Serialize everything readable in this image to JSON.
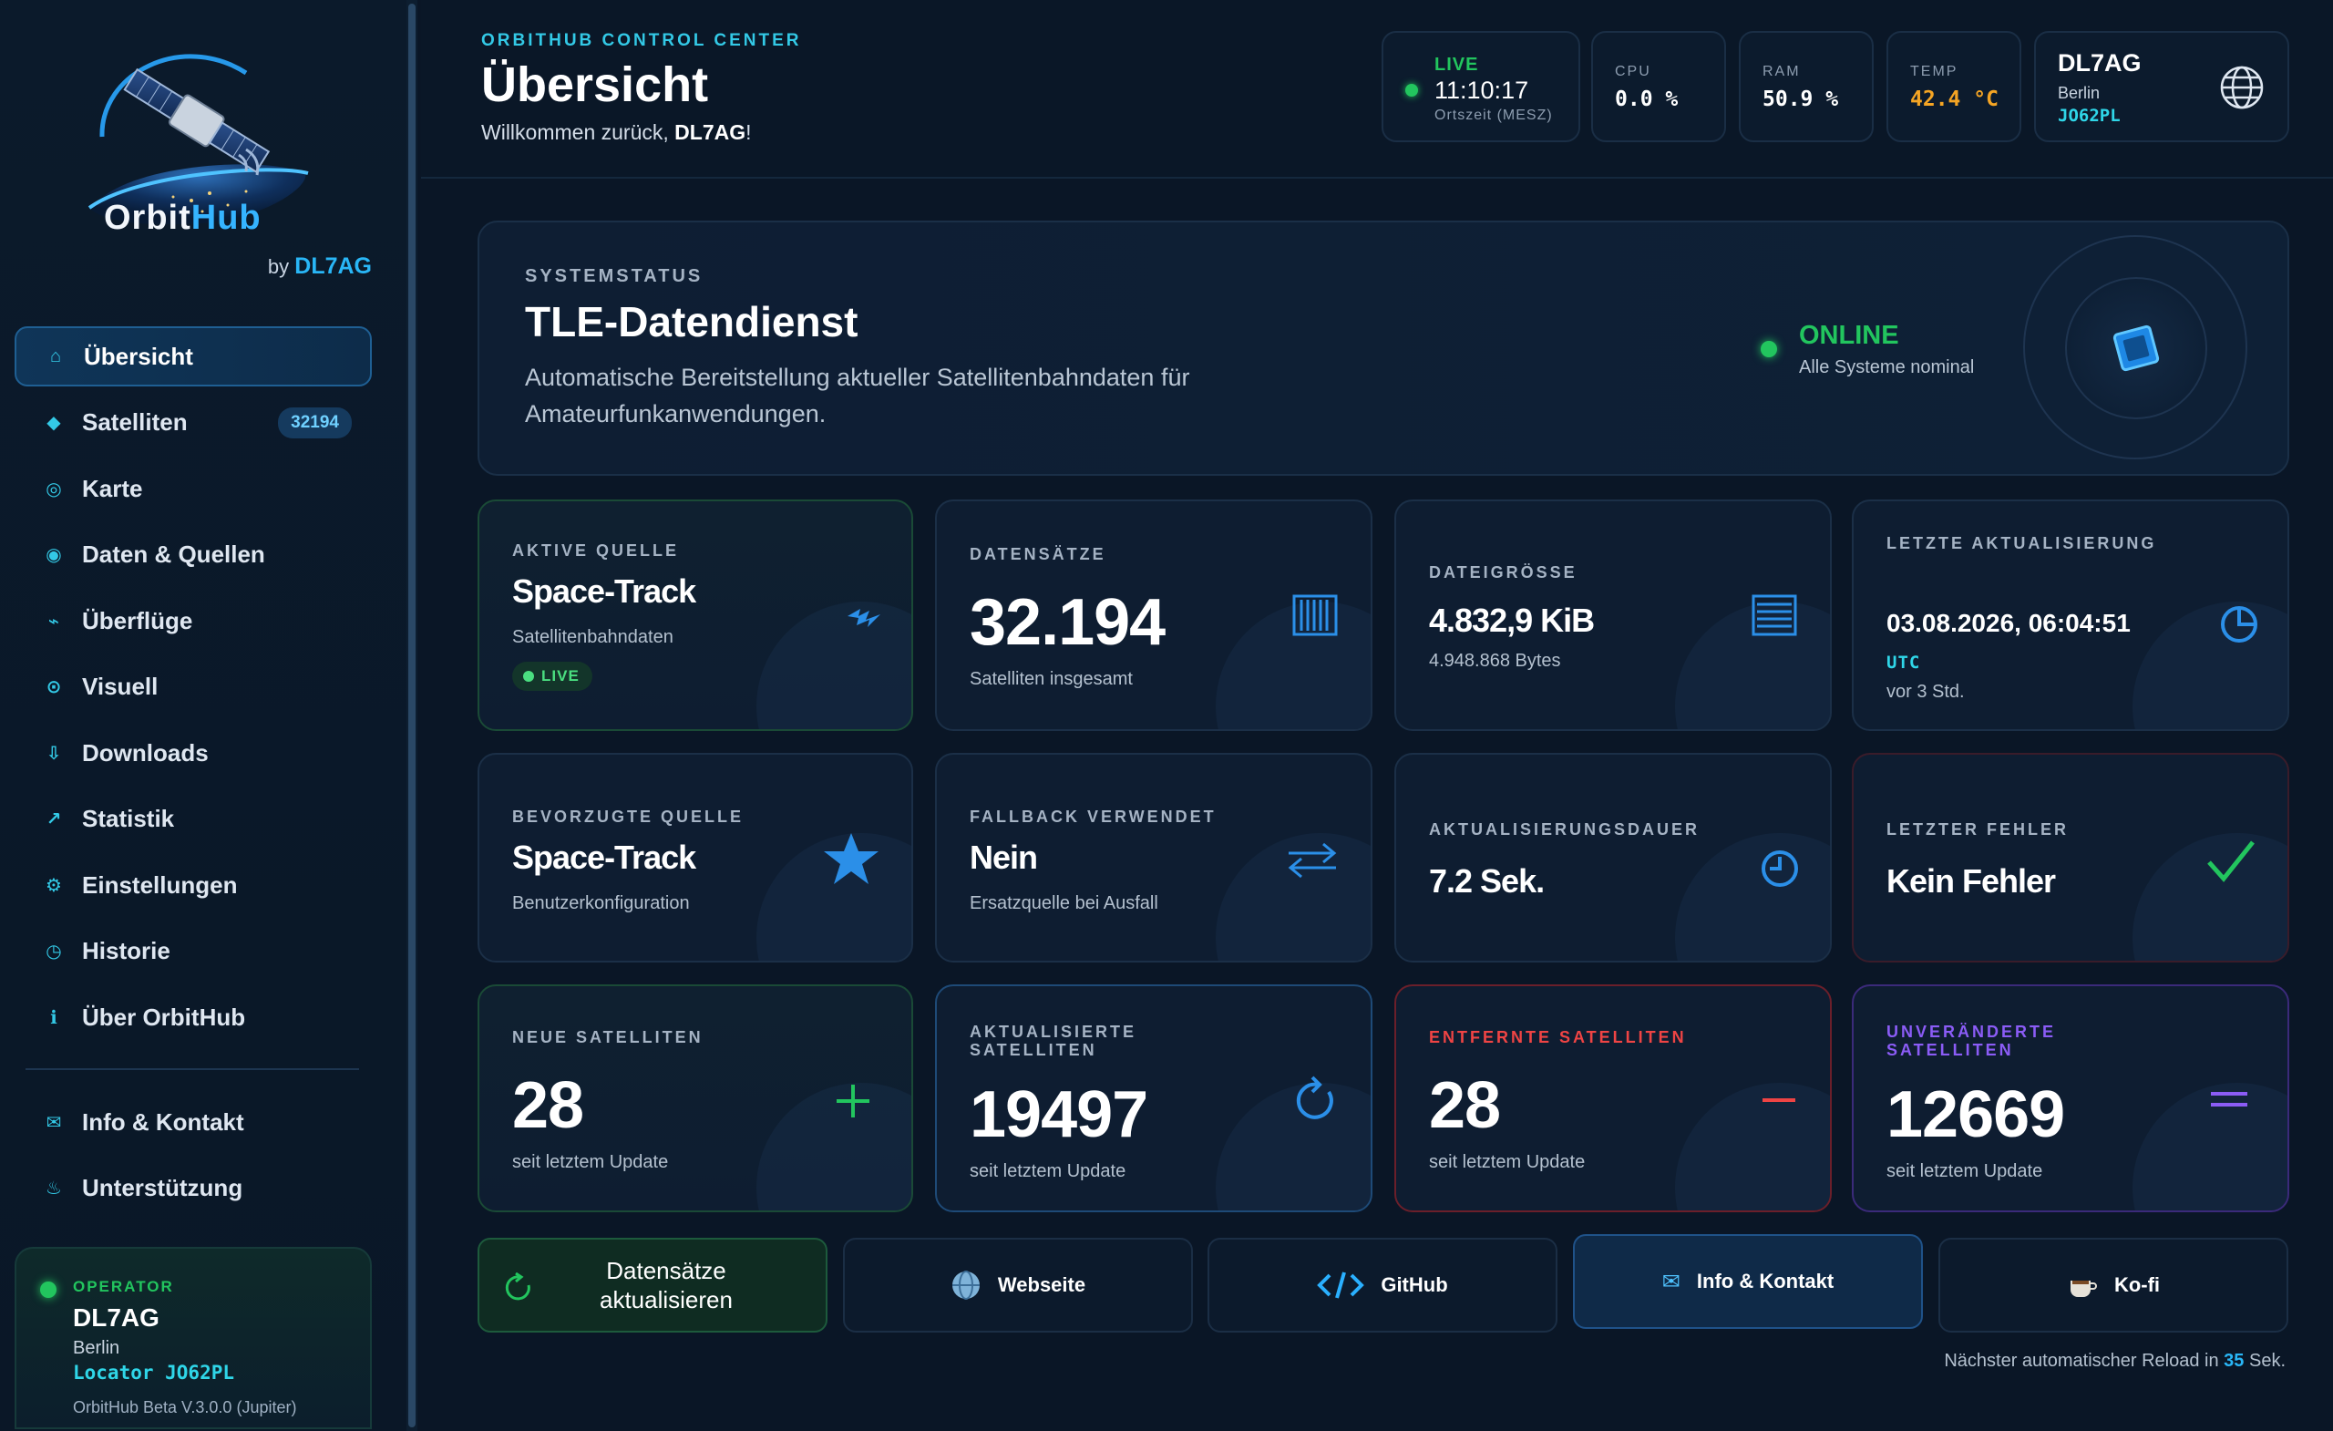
{
  "sidebar": {
    "logo": {
      "text_a": "Orbit",
      "text_b": "Hub"
    },
    "byline": {
      "prefix": "by",
      "author": "DL7AG"
    },
    "nav": [
      {
        "label": "Übersicht",
        "icon": "home-icon",
        "glyph": "⌂",
        "active": true
      },
      {
        "label": "Satelliten",
        "icon": "diamond-icon",
        "glyph": "◆",
        "badge": "32194"
      },
      {
        "label": "Karte",
        "icon": "target-icon",
        "glyph": "◎"
      },
      {
        "label": "Daten & Quellen",
        "icon": "database-icon",
        "glyph": "◉"
      },
      {
        "label": "Überflüge",
        "icon": "pass-icon",
        "glyph": "⌁"
      },
      {
        "label": "Visuell",
        "icon": "eye-icon",
        "glyph": "⊙"
      },
      {
        "label": "Downloads",
        "icon": "download-icon",
        "glyph": "⇩"
      },
      {
        "label": "Statistik",
        "icon": "trend-icon",
        "glyph": "↗"
      },
      {
        "label": "Einstellungen",
        "icon": "gear-icon",
        "glyph": "⚙"
      },
      {
        "label": "Historie",
        "icon": "history-icon",
        "glyph": "◷"
      },
      {
        "label": "Über OrbitHub",
        "icon": "info-icon",
        "glyph": "ℹ"
      }
    ],
    "nav2": [
      {
        "label": "Info & Kontakt",
        "icon": "mail-icon",
        "glyph": "✉"
      },
      {
        "label": "Unterstützung",
        "icon": "coffee-icon",
        "glyph": "♨"
      }
    ],
    "operator": {
      "label": "OPERATOR",
      "callsign": "DL7AG",
      "city": "Berlin",
      "locator": "Locator JO62PL",
      "version": "OrbitHub Beta V.3.0.0 (Jupiter)"
    }
  },
  "header": {
    "kicker": "ORBITHUB CONTROL CENTER",
    "title": "Übersicht",
    "welcome_prefix": "Willkommen zurück, ",
    "welcome_user": "DL7AG",
    "welcome_suffix": "!",
    "live": {
      "label": "LIVE",
      "time": "11:10:17",
      "sub": "Ortszeit (MESZ)"
    },
    "cpu": {
      "label": "CPU",
      "value": "0.0 %"
    },
    "ram": {
      "label": "RAM",
      "value": "50.9 %"
    },
    "temp": {
      "label": "TEMP",
      "value": "42.4 °C",
      "color": "#f5a524"
    },
    "user": {
      "callsign": "DL7AG",
      "city": "Berlin",
      "locator": "JO62PL"
    }
  },
  "status": {
    "kicker": "SYSTEMSTATUS",
    "title": "TLE-Datendienst",
    "description": "Automatische Bereitstellung aktueller Satellitenbahndaten für Amateurfunkanwendungen.",
    "state": "ONLINE",
    "state_sub": "Alle Systeme nominal",
    "state_color": "#22c55e"
  },
  "cards": {
    "active_source": {
      "label": "AKTIVE QUELLE",
      "value": "Space-Track",
      "sub": "Satellitenbahndaten",
      "pill": "LIVE"
    },
    "records": {
      "label": "DATENSÄTZE",
      "value": "32.194",
      "sub": "Satelliten insgesamt"
    },
    "filesize": {
      "label": "DATEIGRÖSSE",
      "value": "4.832,9 KiB",
      "sub": "4.948.868 Bytes"
    },
    "last_update": {
      "label": "LETZTE AKTUALISIERUNG",
      "value": "03.08.2026, 06:04:51",
      "tz": "UTC",
      "sub": "vor 3 Std."
    },
    "preferred_source": {
      "label": "BEVORZUGTE QUELLE",
      "value": "Space-Track",
      "sub": "Benutzerkonfiguration"
    },
    "fallback": {
      "label": "FALLBACK VERWENDET",
      "value": "Nein",
      "sub": "Ersatzquelle bei Ausfall"
    },
    "duration": {
      "label": "AKTUALISIERUNGSDAUER",
      "value": "7.2 Sek."
    },
    "last_error": {
      "label": "LETZTER FEHLER",
      "value": "Kein Fehler"
    },
    "new_sats": {
      "label": "NEUE SATELLITEN",
      "value": "28",
      "sub": "seit letztem Update",
      "color": "#22c55e"
    },
    "updated_sats": {
      "label": "AKTUALISIERTE SATELLITEN",
      "value": "19497",
      "sub": "seit letztem Update",
      "color": "#2b8fe8"
    },
    "removed_sats": {
      "label": "ENTFERNTE SATELLITEN",
      "value": "28",
      "sub": "seit letztem Update",
      "color": "#ef4444"
    },
    "unchanged_sats": {
      "label": "UNVERÄNDERTE SATELLITEN",
      "value": "12669",
      "sub": "seit letztem Update",
      "color": "#8b5cf6"
    }
  },
  "actions": {
    "refresh": "Datensätze aktualisieren",
    "website": "Webseite",
    "github": "GitHub",
    "contact": "Info & Kontakt",
    "kofi": "Ko-fi"
  },
  "reload": {
    "prefix": "Nächster automatischer Reload in ",
    "seconds": "35",
    "suffix": " Sek."
  }
}
